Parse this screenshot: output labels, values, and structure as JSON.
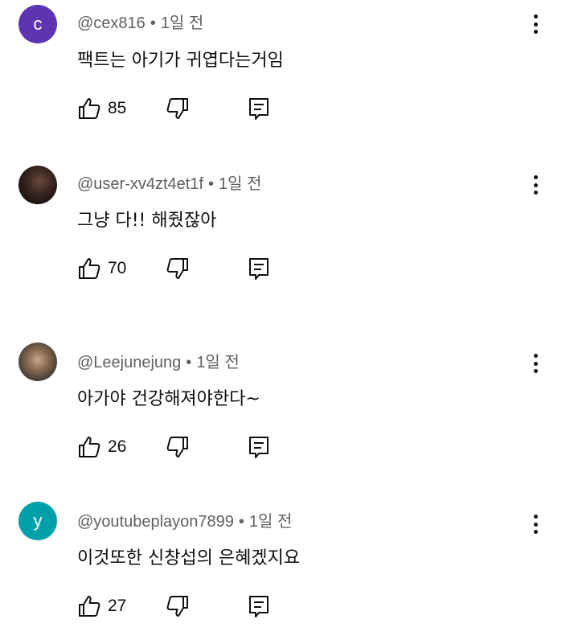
{
  "comments": [
    {
      "author": "@cex816",
      "time": "1일 전",
      "text": "팩트는 아기가 귀엽다는거임",
      "likes": "85",
      "avatar_letter": "c",
      "avatar_color": "#5e35b1"
    },
    {
      "author": "@user-xv4zt4et1f",
      "time": "1일 전",
      "text": "그냥 다!! 해줬잖아",
      "likes": "70"
    },
    {
      "author": "@Leejunejung",
      "time": "1일 전",
      "text": "아가야 건강해져야한다~",
      "likes": "26"
    },
    {
      "author": "@youtubeplayon7899",
      "time": "1일 전",
      "text": "이것또한 신창섭의 은혜겠지요",
      "likes": "27",
      "avatar_letter": "y",
      "avatar_color": "#00a0a8"
    }
  ],
  "separator": "•",
  "icons": {
    "like": "thumbs-up-icon",
    "dislike": "thumbs-down-icon",
    "reply": "reply-icon",
    "more": "more-vertical-icon"
  }
}
